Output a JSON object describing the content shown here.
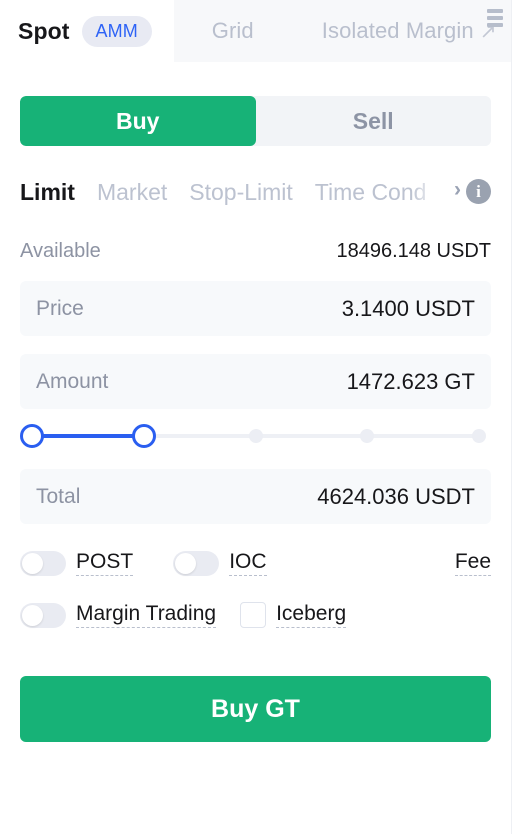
{
  "tabs": {
    "spot": {
      "label": "Spot",
      "badge": "AMM"
    },
    "grid": {
      "label": "Grid"
    },
    "isolated_margin": {
      "label": "Isolated Margin",
      "arrow": "↗"
    },
    "menu_icon": "list-menu-icon"
  },
  "side": {
    "buy_label": "Buy",
    "sell_label": "Sell",
    "active": "Buy",
    "buy_color": "#17b277",
    "inactive_bg": "#f2f4f7"
  },
  "order_types": {
    "items": [
      {
        "label": "Limit",
        "active": true
      },
      {
        "label": "Market",
        "active": false
      },
      {
        "label": "Stop-Limit",
        "active": false
      },
      {
        "label": "Time Cond",
        "active": false
      }
    ],
    "more_icon": "chevron-right-icon",
    "more_glyph": "›",
    "info_icon": "info-icon",
    "info_glyph": "i"
  },
  "available": {
    "label": "Available",
    "value": "18496.148 USDT"
  },
  "fields": {
    "price": {
      "label": "Price",
      "value": "3.1400 USDT"
    },
    "amount": {
      "label": "Amount",
      "value": "1472.623 GT"
    },
    "total": {
      "label": "Total",
      "value": "4624.036 USDT"
    }
  },
  "slider": {
    "percent": 25,
    "accent": "#2a5ef0",
    "ticks": [
      0,
      25,
      50,
      75,
      100
    ]
  },
  "options": {
    "post": {
      "label": "POST",
      "on": false
    },
    "ioc": {
      "label": "IOC",
      "on": false
    },
    "fee": {
      "label": "Fee"
    },
    "margin_trading": {
      "label": "Margin Trading",
      "on": false
    },
    "iceberg": {
      "label": "Iceberg",
      "checked": false
    }
  },
  "submit": {
    "label": "Buy GT",
    "color": "#17b277"
  }
}
